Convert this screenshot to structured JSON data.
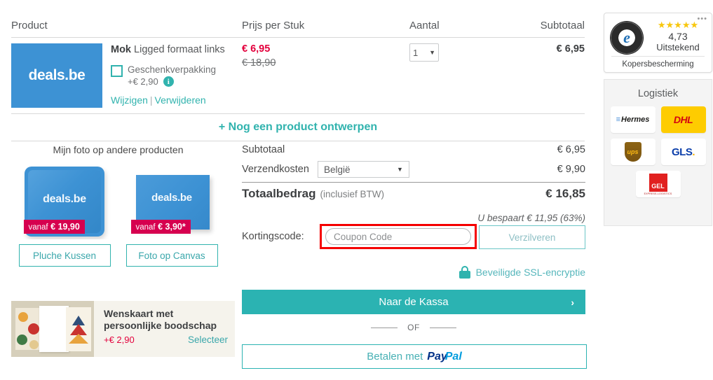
{
  "table_header": {
    "product": "Product",
    "price": "Prijs per Stuk",
    "quantity": "Aantal",
    "subtotal": "Subtotaal"
  },
  "product_row": {
    "thumb_logo": "deals.be",
    "title_bold": "Mok",
    "title_rest": " Ligged formaat links",
    "giftwrap_label": "Geschenkverpakking",
    "giftwrap_price": "+€ 2,90",
    "info_icon": "i",
    "edit_link": "Wijzigen",
    "separator": "|",
    "remove_link": "Verwijderen",
    "price_new": "€ 6,95",
    "price_old": "€ 18,90",
    "quantity_value": "1",
    "subtotal": "€ 6,95"
  },
  "add_product_row": {
    "label": "+ Nog een product ontwerpen"
  },
  "promo": {
    "heading": "Mijn foto op andere producten",
    "tiles": [
      {
        "logo": "deals.be",
        "badge_prefix": "vanaf",
        "badge_price": "€ 19,90",
        "button": "Pluche Kussen"
      },
      {
        "logo": "deals.be",
        "badge_prefix": "vanaf",
        "badge_price": "€ 3,90*",
        "button": "Foto op Canvas"
      }
    ]
  },
  "card_promo": {
    "title_line1": "Wenskaart met",
    "title_line2": "persoonlijke boodschap",
    "price": "+€ 2,90",
    "select_label": "Selecteer"
  },
  "summary": {
    "subtotal_label": "Subtotaal",
    "subtotal_value": "€ 6,95",
    "shipping_label": "Verzendkosten",
    "shipping_country": "België",
    "shipping_value": "€ 9,90",
    "total_label": "Totaalbedrag",
    "total_note": "(inclusief BTW)",
    "total_value": "€ 16,85",
    "saving_text": "U bespaart € 11,95 (63%)"
  },
  "coupon": {
    "label": "Kortingscode:",
    "placeholder": "Coupon Code",
    "value": "",
    "redeem_button": "Verzilveren",
    "highlight_color": "#f50000"
  },
  "ssl": {
    "icon": "lock-icon",
    "text": "Beveiligde SSL-encryptie"
  },
  "checkout": {
    "label": "Naar de Kassa",
    "chevron": "›",
    "or_label": "OF",
    "paypal_prefix": "Betalen met",
    "paypal_pay": "Pay",
    "paypal_pal": "Pal"
  },
  "trusted_shops": {
    "dots": "•••",
    "seal_letter": "e",
    "stars": "★★★★★",
    "score": "4,73",
    "rating_word": "Uitstekend",
    "footer": "Kopersbescherming",
    "star_color": "#f8c70d"
  },
  "logistics": {
    "title": "Logistiek",
    "carriers": [
      {
        "name": "Hermes",
        "label": "Hermes"
      },
      {
        "name": "DHL",
        "label": "DHL"
      },
      {
        "name": "UPS",
        "label": "ups"
      },
      {
        "name": "GLS",
        "label": "GLS",
        "dot": "."
      },
      {
        "name": "GEL",
        "label": "GEL",
        "sub": "EXPRESS-LOGISTICS"
      }
    ]
  },
  "colors": {
    "teal": "#2bb3b2",
    "brand_blue": "#3d92d4",
    "price_red": "#e3003c",
    "badge_magenta": "#d6004f"
  }
}
